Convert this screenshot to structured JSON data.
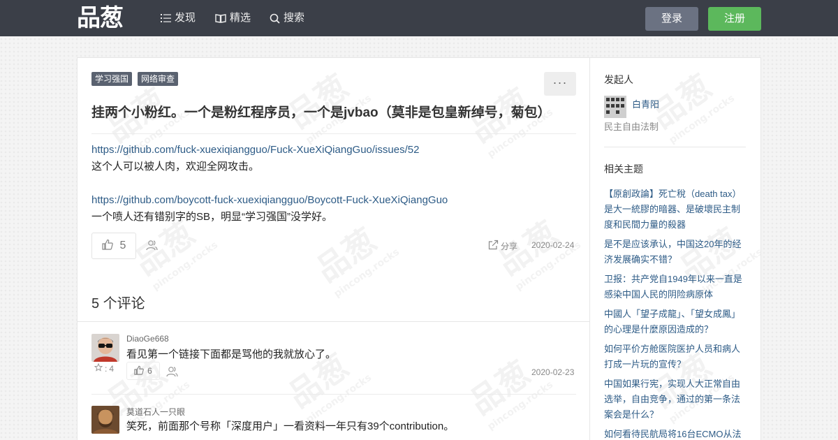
{
  "nav": {
    "logo": "品葱",
    "items": [
      {
        "label": "发现",
        "icon": "list-icon"
      },
      {
        "label": "精选",
        "icon": "book-icon"
      },
      {
        "label": "搜索",
        "icon": "search-icon"
      }
    ],
    "login": "登录",
    "register": "注册",
    "bar_color": "#3b3f48",
    "register_color": "#5cb85c"
  },
  "post": {
    "tags": [
      "学习强国",
      "网络审查"
    ],
    "more": "···",
    "title": "挂两个小粉红。一个是粉红程序员，一个是jvbao（莫非是包皇新绰号，菊包）",
    "body": {
      "link1": "https://github.com/fuck-xuexiqiangguo/Fuck-XueXiQiangGuo/issues/52",
      "line1": "这个人可以被人肉，欢迎全网攻击。",
      "link2": "https://github.com/boycott-fuck-xuexiqiangguo/Boycott-Fuck-XueXiQiangGuo",
      "line2": "一个喷人还有错别字的SB，明显“学习强国”没学好。"
    },
    "likes": "5",
    "share": "分享",
    "date": "2020-02-24"
  },
  "comments": {
    "count_label": "5 个评论",
    "items": [
      {
        "user": "DiaoGe668",
        "text": "看见第一个链接下面都是骂他的我就放心了。",
        "reputation": "4",
        "likes": "6",
        "date": "2020-02-23"
      },
      {
        "user": "莫道石人一只眼",
        "text": "笑死，前面那个号称「深度用户」一看资料一年只有39个contribution。"
      }
    ]
  },
  "sidebar": {
    "starter_heading": "发起人",
    "starter_name": "白青阳",
    "starter_tagline": "民主自由法制",
    "related_heading": "相关主题",
    "related": [
      "【原創政論】死亡稅（death tax）是大一統膠的暗器、是破壞民主制度和民間力量的殺器",
      "是不是应该承认，中国这20年的经济发展确实不错？",
      "卫报：共产党自1949年以来一直是感染中国人民的阴险病原体",
      "中國人「望子成龍」、「望女成鳳」的心理是什麼原因造成的？",
      "如何平价方舱医院医护人员和病人打成一片玩的宣传？",
      "中国如果行宪，实现人大正常自由选举，自由竞争，通过的第一条法案会是什么？",
      "如何看待民航局将16台ECMO从法"
    ]
  }
}
